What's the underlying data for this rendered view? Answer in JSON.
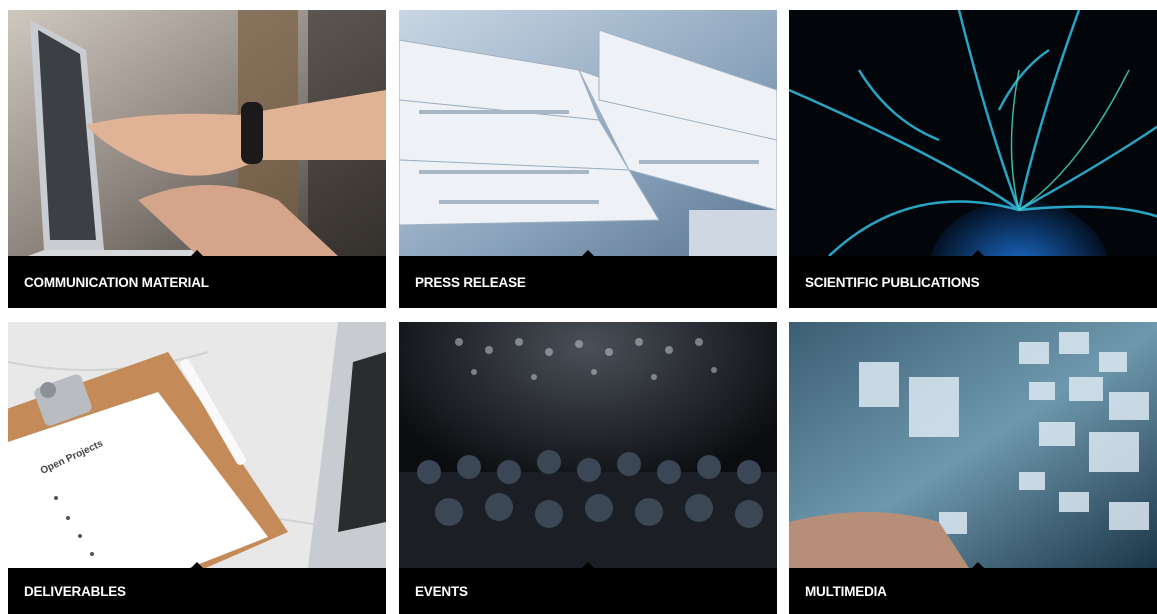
{
  "cards": [
    {
      "label": "COMMUNICATION MATERIAL",
      "image": "laptop-pointing-hands-photo"
    },
    {
      "label": "PRESS RELEASE",
      "image": "newspapers-stack-photo"
    },
    {
      "label": "SCIENTIFIC PUBLICATIONS",
      "image": "plasma-ball-photo"
    },
    {
      "label": "DELIVERABLES",
      "image": "clipboard-open-projects-photo",
      "clipboard_text": "Open Projects"
    },
    {
      "label": "EVENTS",
      "image": "conference-audience-photo"
    },
    {
      "label": "MULTIMEDIA",
      "image": "digital-media-wall-photo"
    }
  ],
  "colors": {
    "caption_bg": "#000000",
    "caption_text": "#ffffff",
    "page_bg": "#ffffff"
  }
}
